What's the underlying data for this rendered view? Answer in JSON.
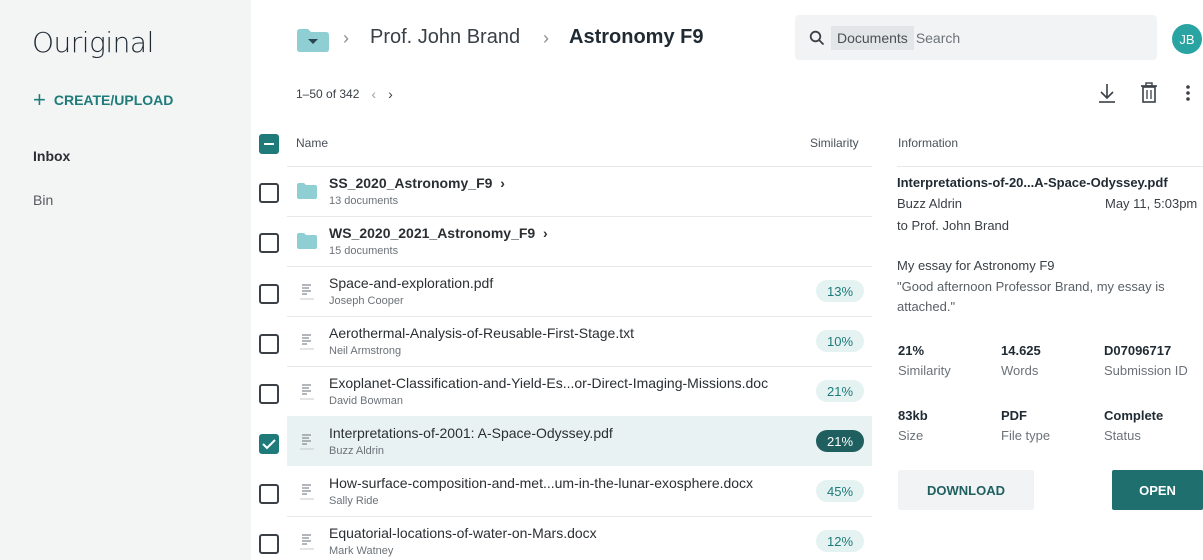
{
  "app": {
    "logo": "Ouriginal"
  },
  "sidebar": {
    "create_label": "CREATE/UPLOAD",
    "items": [
      {
        "label": "Inbox"
      },
      {
        "label": "Bin"
      }
    ]
  },
  "breadcrumb": {
    "parent": "Prof. John Brand",
    "current": "Astronomy F9"
  },
  "search": {
    "scope": "Documents",
    "placeholder": "Search"
  },
  "user": {
    "initials": "JB"
  },
  "pager": {
    "range": "1–50 of 342"
  },
  "table": {
    "headers": {
      "name": "Name",
      "similarity": "Similarity",
      "information": "Information"
    },
    "rows": [
      {
        "title": "SS_2020_Astronomy_F9",
        "subtitle": "13 documents",
        "type": "folder",
        "similarity": ""
      },
      {
        "title": "WS_2020_2021_Astronomy_F9",
        "subtitle": "15 documents",
        "type": "folder",
        "similarity": ""
      },
      {
        "title": "Space-and-exploration.pdf",
        "subtitle": "Joseph Cooper",
        "type": "file",
        "similarity": "13%"
      },
      {
        "title": "Aerothermal-Analysis-of-Reusable-First-Stage.txt",
        "subtitle": "Neil Armstrong",
        "type": "file",
        "similarity": "10%"
      },
      {
        "title": "Exoplanet-Classification-and-Yield-Es...or-Direct-Imaging-Missions.doc",
        "subtitle": "David Bowman",
        "type": "file",
        "similarity": "21%"
      },
      {
        "title": "Interpretations-of-2001: A-Space-Odyssey.pdf",
        "subtitle": "Buzz Aldrin",
        "type": "file",
        "similarity": "21%",
        "selected": true
      },
      {
        "title": "How-surface-composition-and-met...um-in-the-lunar-exosphere.docx",
        "subtitle": "Sally Ride",
        "type": "file",
        "similarity": "45%"
      },
      {
        "title": "Equatorial-locations-of-water-on-Mars.docx",
        "subtitle": "Mark Watney",
        "type": "file",
        "similarity": "12%"
      }
    ]
  },
  "info": {
    "filename": "Interpretations-of-20...A-Space-Odyssey.pdf",
    "author": "Buzz Aldrin",
    "date": "May 11, 5:03pm",
    "recipient": "to Prof. John Brand",
    "subject": "My essay for Astronomy F9",
    "message": "\"Good afternoon Professor Brand, my essay is attached.\"",
    "stats": [
      {
        "value": "21%",
        "label": "Similarity"
      },
      {
        "value": "14.625",
        "label": "Words"
      },
      {
        "value": "D07096717",
        "label": "Submission ID"
      },
      {
        "value": "83kb",
        "label": "Size"
      },
      {
        "value": "PDF",
        "label": "File type"
      },
      {
        "value": "Complete",
        "label": "Status"
      }
    ],
    "download_label": "DOWNLOAD",
    "open_label": "OPEN"
  },
  "colors": {
    "accent": "#1f7a7a",
    "sidebar_bg": "#f3f5f5",
    "badge_bg": "#e4f2f2",
    "selected_bg": "#e9f2f2"
  },
  "icons": [
    "folder-icon",
    "search-icon",
    "download-icon",
    "trash-icon",
    "more-vertical-icon",
    "plus-icon",
    "document-icon",
    "check-icon"
  ]
}
